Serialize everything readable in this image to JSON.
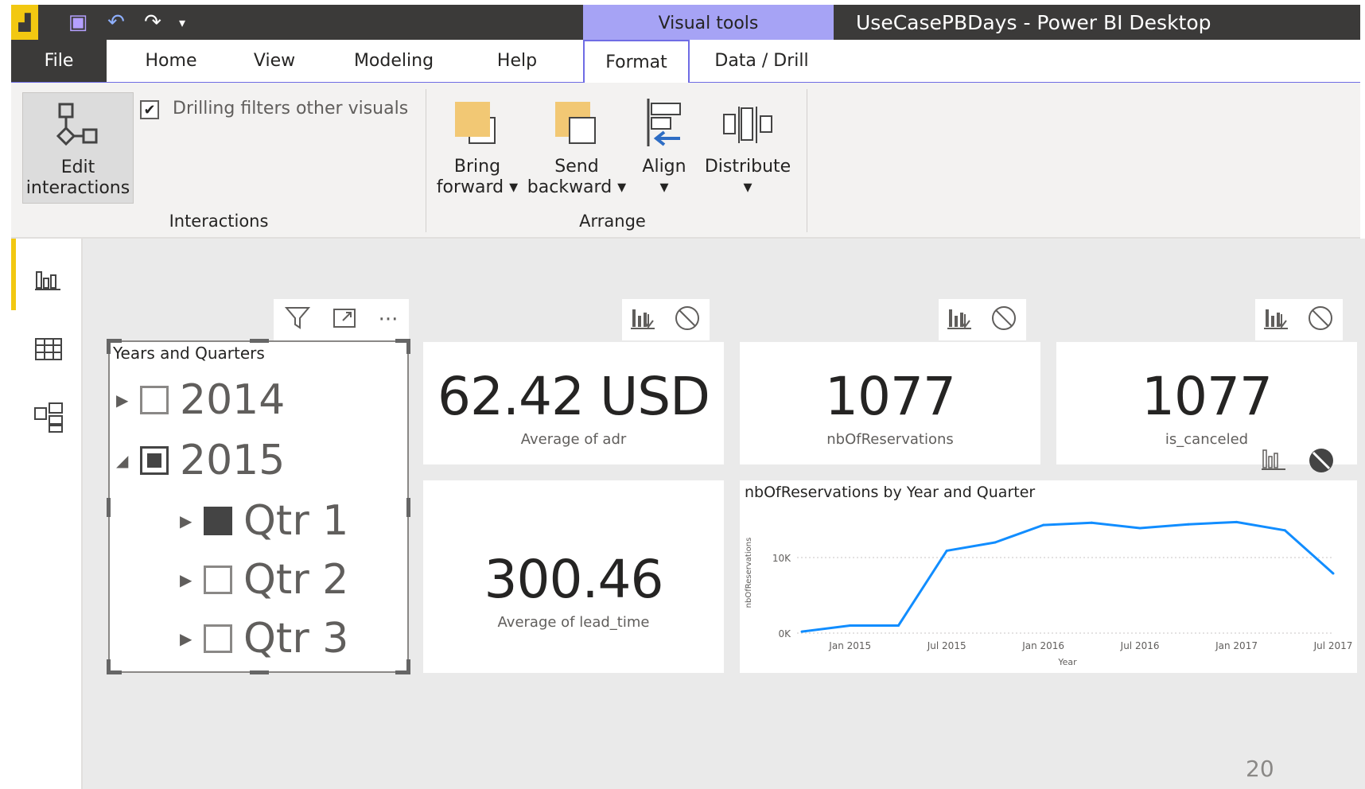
{
  "titlebar": {
    "visual_tools": "Visual tools",
    "app_title": "UseCasePBDays - Power BI Desktop"
  },
  "tabs": [
    {
      "label": "File"
    },
    {
      "label": "Home"
    },
    {
      "label": "View"
    },
    {
      "label": "Modeling"
    },
    {
      "label": "Help"
    },
    {
      "label": "Format"
    },
    {
      "label": "Data / Drill"
    }
  ],
  "ribbon": {
    "interactions": {
      "edit_label_1": "Edit",
      "edit_label_2": "interactions",
      "drilling_checkbox_label": "Drilling filters other visuals",
      "drilling_checked": true,
      "group_label": "Interactions"
    },
    "arrange": {
      "bring_1": "Bring",
      "bring_2": "forward",
      "send_1": "Send",
      "send_2": "backward",
      "align": "Align",
      "distribute": "Distribute",
      "group_label": "Arrange"
    }
  },
  "slicer": {
    "title": "Years and Quarters",
    "items": [
      {
        "label": "2014",
        "state": "empty",
        "expanded": false
      },
      {
        "label": "2015",
        "state": "partial",
        "expanded": true
      },
      {
        "label": "Qtr 1",
        "state": "checked",
        "expanded": false
      },
      {
        "label": "Qtr 2",
        "state": "empty",
        "expanded": false
      },
      {
        "label": "Qtr 3",
        "state": "empty",
        "expanded": false
      }
    ]
  },
  "cards": {
    "adr": {
      "value": "62.42 USD",
      "label": "Average of adr"
    },
    "reservations": {
      "value": "1077",
      "label": "nbOfReservations"
    },
    "canceled": {
      "value": "1077",
      "label": "is_canceled"
    },
    "lead_time": {
      "value": "300.46",
      "label": "Average of lead_time"
    }
  },
  "page_number": "20",
  "chart_data": {
    "type": "line",
    "title": "nbOfReservations by Year and Quarter",
    "xlabel": "Year",
    "ylabel": "nbOfReservations",
    "x_ticks": [
      "Jan 2015",
      "Jul 2015",
      "Jan 2016",
      "Jul 2016",
      "Jan 2017",
      "Jul 2017"
    ],
    "y_ticks": [
      "0K",
      "10K"
    ],
    "ylim": [
      0,
      16000
    ],
    "color": "#118dff",
    "x": [
      "Oct 2014",
      "Jan 2015",
      "Apr 2015",
      "Jul 2015",
      "Oct 2015",
      "Jan 2016",
      "Apr 2016",
      "Jul 2016",
      "Oct 2016",
      "Jan 2017",
      "Apr 2017",
      "Jul 2017"
    ],
    "values": [
      200,
      1000,
      1000,
      10900,
      12000,
      14300,
      14600,
      13900,
      14400,
      14700,
      13600,
      7900
    ]
  }
}
